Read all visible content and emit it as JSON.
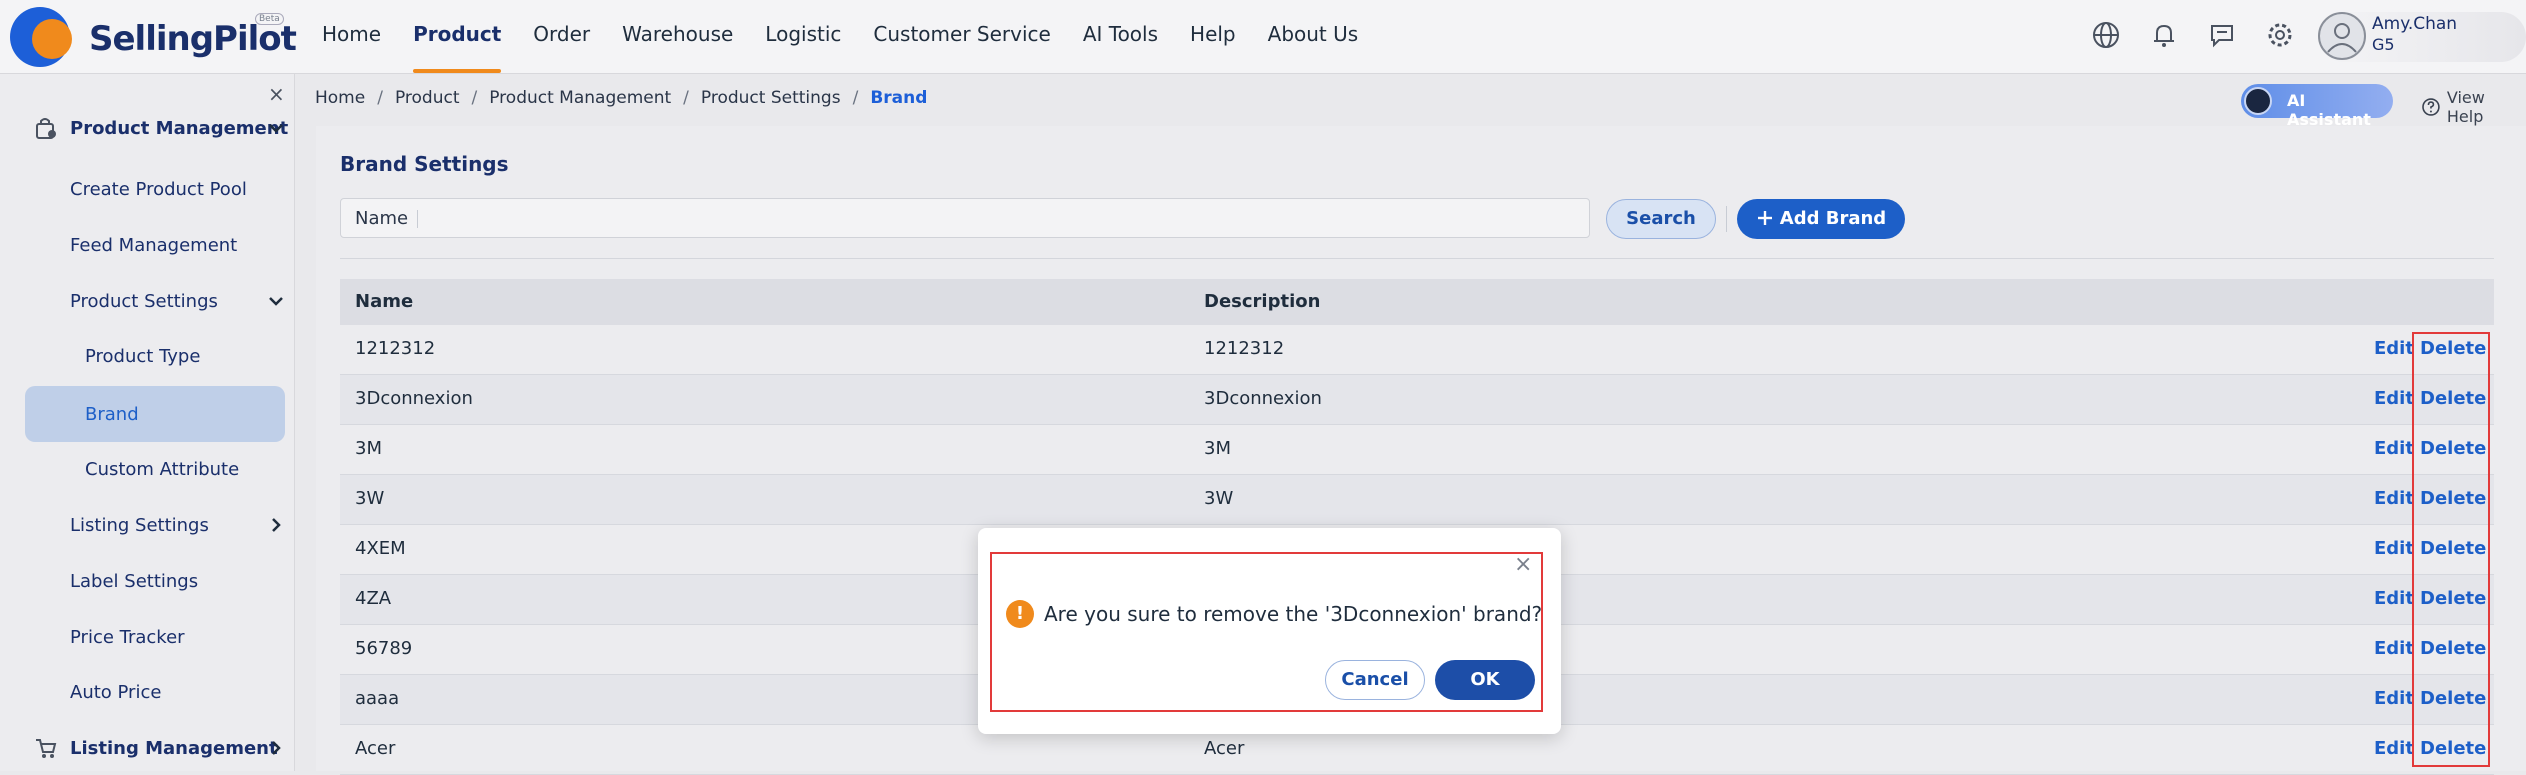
{
  "brand": {
    "name": "SellingPilot",
    "badge": "Beta"
  },
  "nav": {
    "items": [
      {
        "label": "Home"
      },
      {
        "label": "Product",
        "active": true
      },
      {
        "label": "Order"
      },
      {
        "label": "Warehouse"
      },
      {
        "label": "Logistic"
      },
      {
        "label": "Customer Service"
      },
      {
        "label": "AI Tools"
      },
      {
        "label": "Help"
      },
      {
        "label": "About Us"
      }
    ]
  },
  "user": {
    "name": "Amy.Chan",
    "group": "G5"
  },
  "icons": [
    "globe-icon",
    "bell-icon",
    "message-icon",
    "gear-icon",
    "avatar"
  ],
  "sidebar": {
    "close": "×",
    "items": [
      {
        "label": "Product Management"
      },
      {
        "label": "Create Product Pool"
      },
      {
        "label": "Feed Management"
      },
      {
        "label": "Product Settings"
      },
      {
        "label": "Product Type"
      },
      {
        "label": "Brand",
        "active": true
      },
      {
        "label": "Custom Attribute"
      },
      {
        "label": "Listing Settings"
      },
      {
        "label": "Label Settings"
      },
      {
        "label": "Price Tracker"
      },
      {
        "label": "Auto Price"
      },
      {
        "label": "Listing Management"
      }
    ]
  },
  "breadcrumb": [
    "Home",
    "Product",
    "Product Management",
    "Product Settings",
    "Brand"
  ],
  "ai_assistant": "AI Assistant",
  "view_help": "View Help",
  "page": {
    "title": "Brand Settings",
    "filter_label": "Name",
    "filter_value": "",
    "search_label": "Search",
    "add_label": "Add Brand"
  },
  "table": {
    "headers": [
      "Name",
      "Description"
    ],
    "action_edit": "Edit",
    "action_delete": "Delete",
    "rows": [
      {
        "name": "1212312",
        "desc": "1212312"
      },
      {
        "name": "3Dconnexion",
        "desc": "3Dconnexion"
      },
      {
        "name": "3M",
        "desc": "3M"
      },
      {
        "name": "3W",
        "desc": "3W"
      },
      {
        "name": "4XEM",
        "desc": ""
      },
      {
        "name": "4ZA",
        "desc": ""
      },
      {
        "name": "56789",
        "desc": ""
      },
      {
        "name": "aaaa",
        "desc": ""
      },
      {
        "name": "Acer",
        "desc": "Acer"
      }
    ]
  },
  "dialog": {
    "message": "Are you sure to remove the '3Dconnexion' brand?",
    "cancel": "Cancel",
    "ok": "OK"
  },
  "colors": {
    "accent": "#1d5fc8",
    "highlight": "#f08a1c",
    "annotation": "#e23a3a"
  }
}
